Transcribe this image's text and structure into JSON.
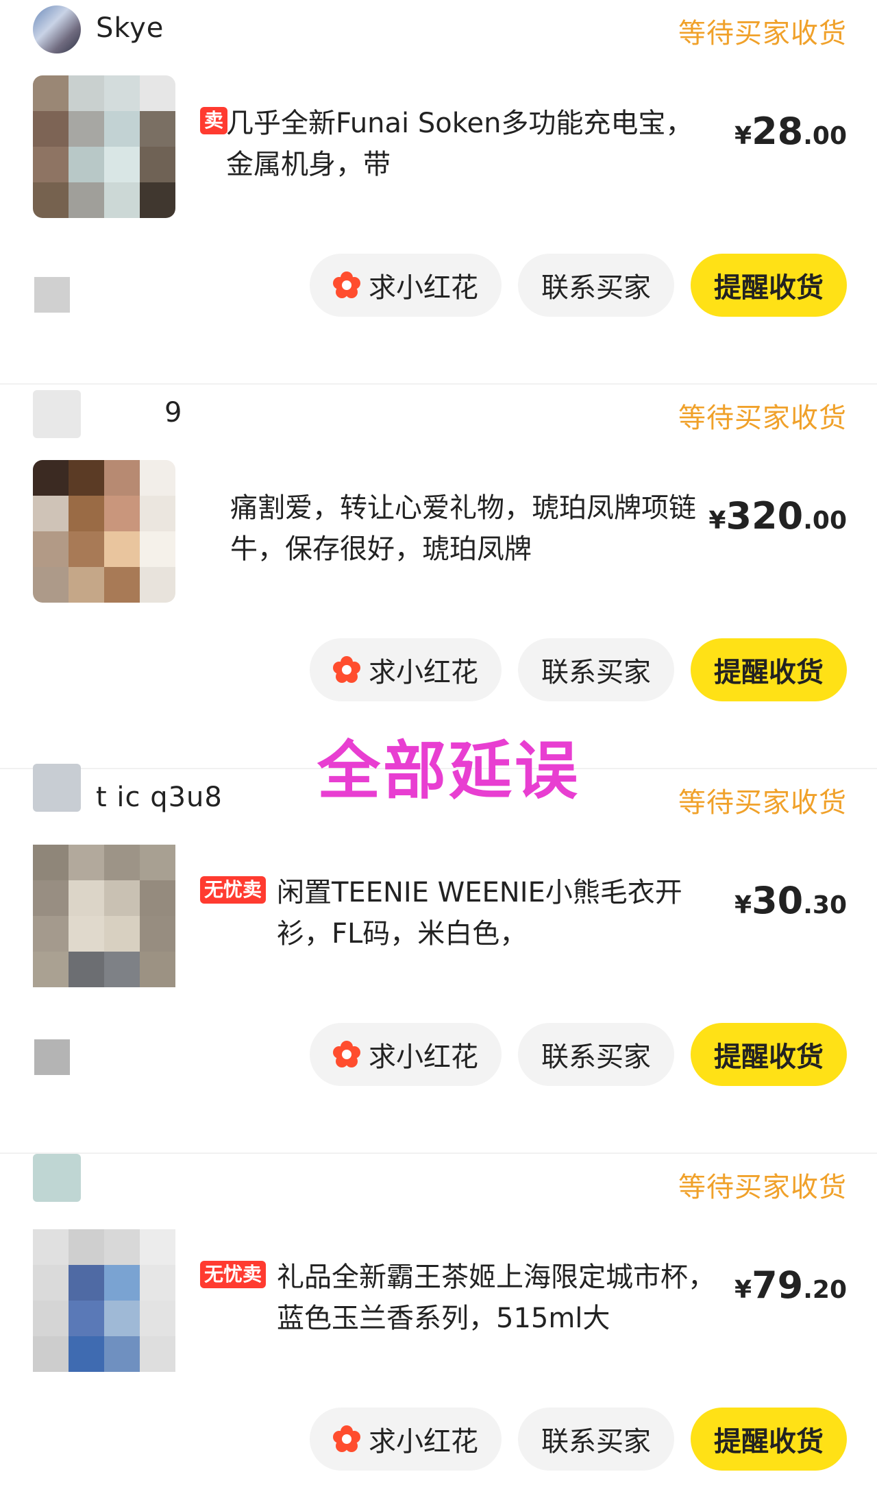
{
  "orders": [
    {
      "user": "Skye",
      "status": "等待买家收货",
      "badge": "卖",
      "title": "几乎全新Funai Soken多功能充电宝，金属机身，带",
      "price": {
        "currency": "¥",
        "integer": "28",
        "decimal": ".00"
      },
      "buttons": {
        "flower": "求小红花",
        "contact": "联系买家",
        "remind": "提醒收货"
      }
    },
    {
      "user": "9",
      "status": "等待买家收货",
      "badge": "",
      "title": "痛割爱，转让心爱礼物，琥珀凤牌项链牛，保存很好，琥珀凤牌",
      "price": {
        "currency": "¥",
        "integer": "320",
        "decimal": ".00"
      },
      "buttons": {
        "flower": "求小红花",
        "contact": "联系买家",
        "remind": "提醒收货"
      }
    },
    {
      "user": "t ic q3u8",
      "status": "等待买家收货",
      "badge": "无忧卖",
      "title": "闲置TEENIE WEENIE小熊毛衣开衫，FL码，米白色，",
      "price": {
        "currency": "¥",
        "integer": "30",
        "decimal": ".30"
      },
      "buttons": {
        "flower": "求小红花",
        "contact": "联系买家",
        "remind": "提醒收货"
      }
    },
    {
      "user": "",
      "status": "等待买家收货",
      "badge": "无忧卖",
      "title": "礼品全新霸王茶姬上海限定城市杯，蓝色玉兰香系列，515ml大",
      "price": {
        "currency": "¥",
        "integer": "79",
        "decimal": ".20"
      },
      "buttons": {
        "flower": "求小红花",
        "contact": "联系买家",
        "remind": "提醒收货"
      }
    }
  ],
  "overlay": {
    "text": "全部延误"
  },
  "colors": {
    "status": "#f0a12a",
    "primary_button": "#ffe116",
    "badge": "#ff3b30",
    "overlay": "#e83ed1"
  }
}
